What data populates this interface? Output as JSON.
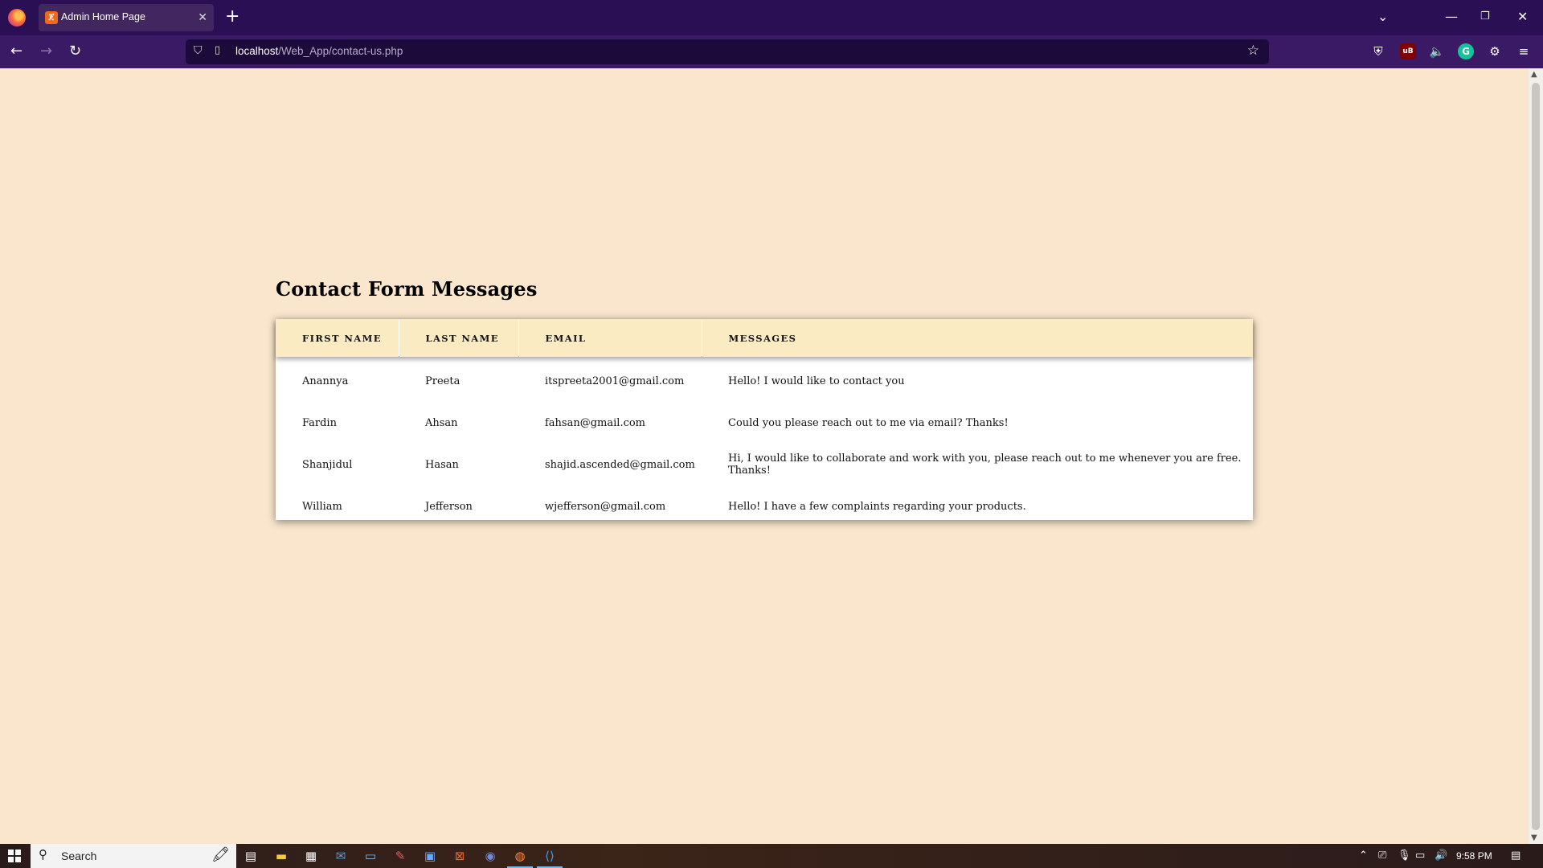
{
  "browser": {
    "tab_title": "Admin Home Page",
    "url_host": "localhost",
    "url_path": "/Web_App/contact-us.php"
  },
  "page": {
    "heading": "Contact Form Messages",
    "columns": [
      "FIRST NAME",
      "LAST NAME",
      "EMAIL",
      "MESSAGES"
    ],
    "rows": [
      {
        "first": "Anannya",
        "last": "Preeta",
        "email": "itspreeta2001@gmail.com",
        "message": "Hello! I would like to contact you"
      },
      {
        "first": "Fardin",
        "last": "Ahsan",
        "email": "fahsan@gmail.com",
        "message": "Could you please reach out to me via email? Thanks!"
      },
      {
        "first": "Shanjidul",
        "last": "Hasan",
        "email": "shajid.ascended@gmail.com",
        "message": "Hi, I would like to collaborate and work with you, please reach out to me whenever you are free. Thanks!"
      },
      {
        "first": "William",
        "last": "Jefferson",
        "email": "wjefferson@gmail.com",
        "message": "Hello! I have a few complaints regarding your products."
      }
    ]
  },
  "taskbar": {
    "search_label": "Search",
    "clock": "9:58 PM"
  },
  "colors": {
    "page_bg": "#f9e6cc",
    "table_header_bg": "#fbebc3",
    "browser_frame": "#2a0f55"
  }
}
